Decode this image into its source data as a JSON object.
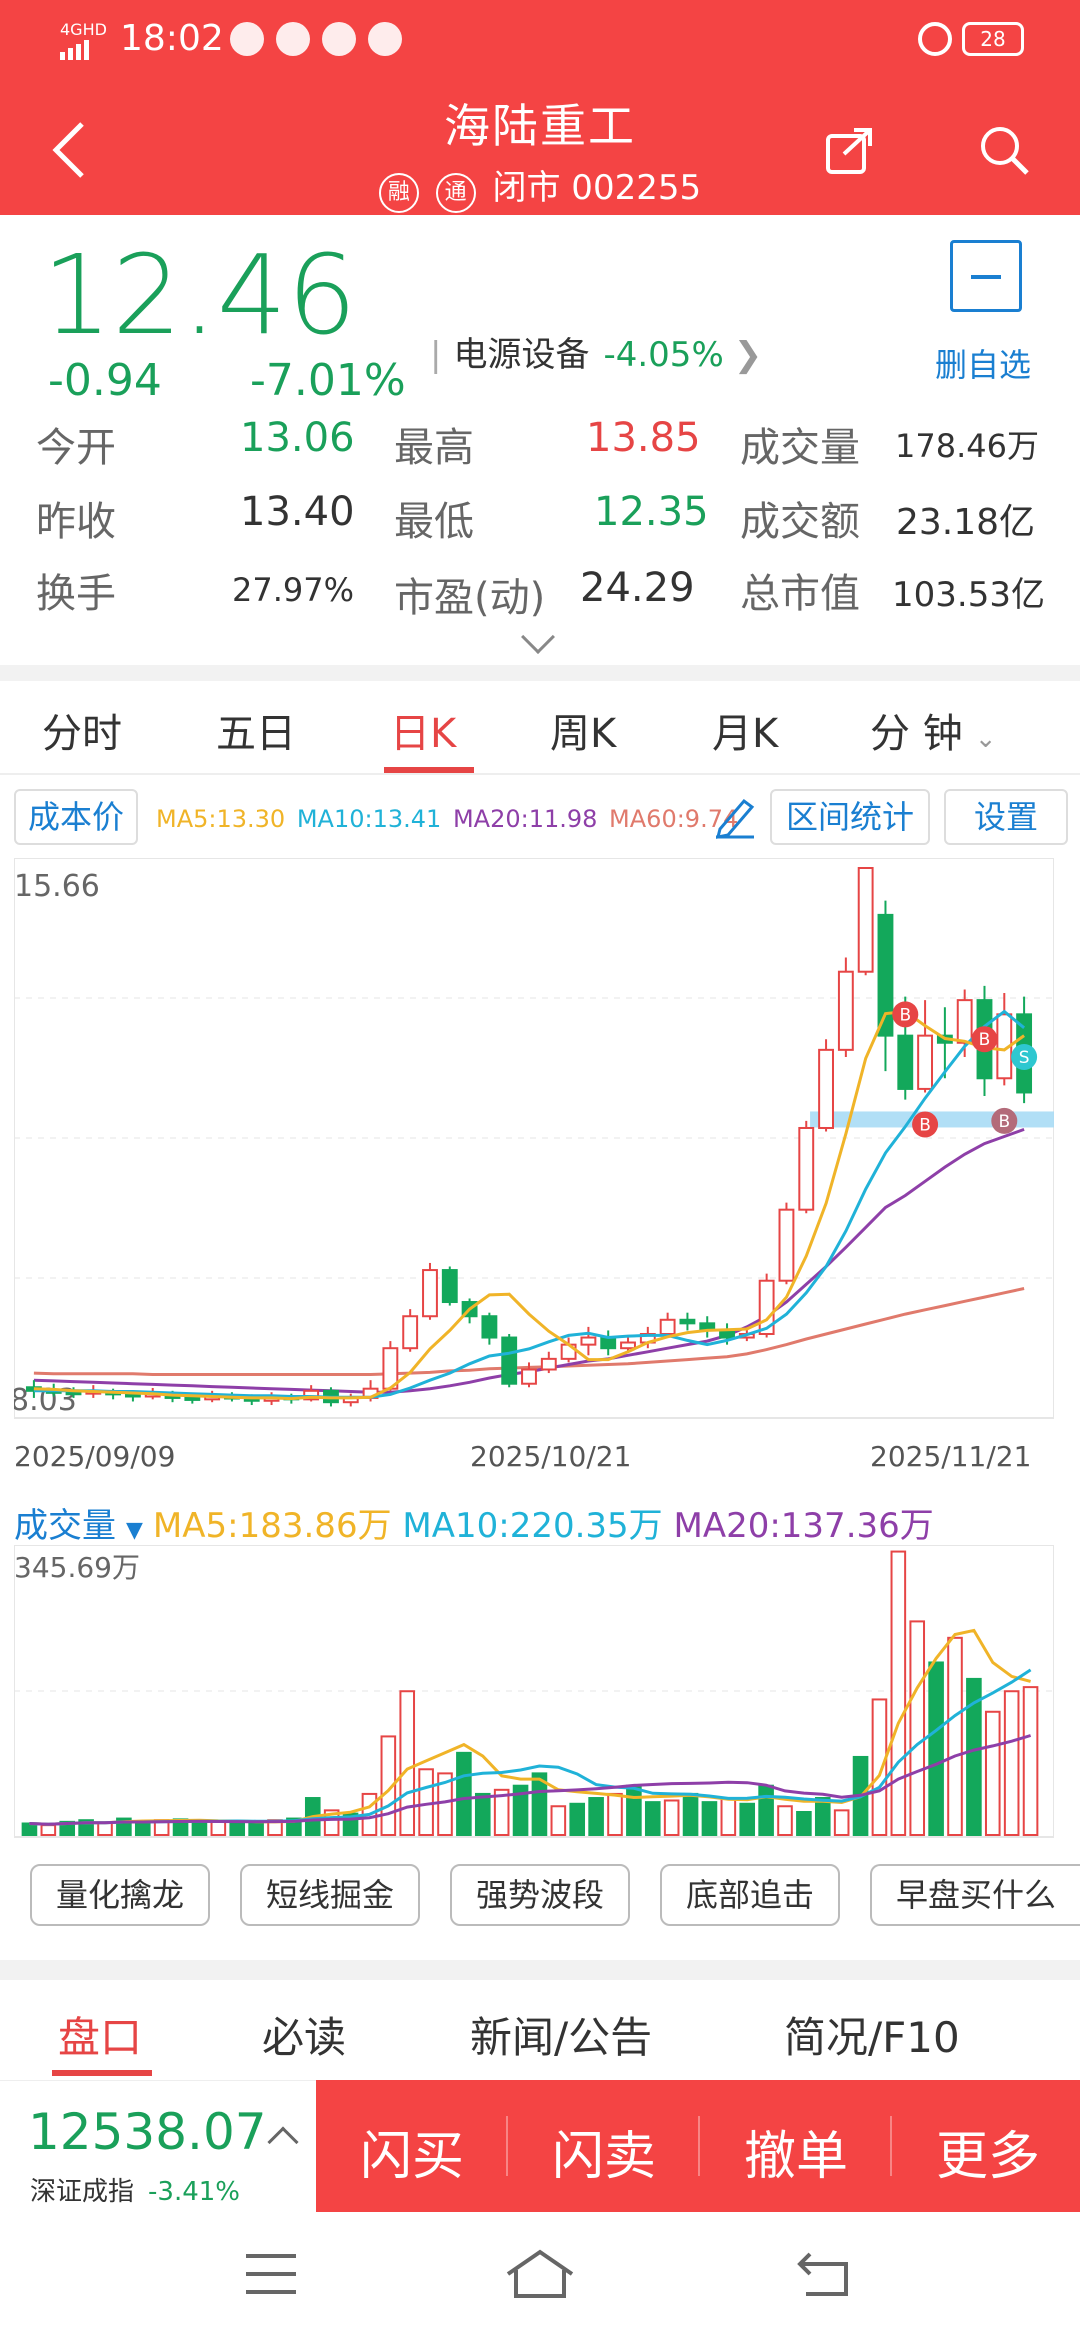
{
  "status_bar": {
    "network": "4GHD",
    "time": "18:02",
    "battery": "28"
  },
  "header": {
    "stock_name": "海陆重工",
    "badge_rong": "融",
    "badge_tong": "通",
    "status_code": "闭市 002255"
  },
  "quote": {
    "price": "12.46",
    "change": "-0.94",
    "change_pct": "-7.01%",
    "sector_name": "电源设备",
    "sector_change": "-4.05%",
    "watch_label": "删自选",
    "fields": {
      "open_label": "今开",
      "open": "13.06",
      "high_label": "最高",
      "high": "13.85",
      "volume_label": "成交量",
      "volume": "178.46万",
      "prev_label": "昨收",
      "prev": "13.40",
      "low_label": "最低",
      "low": "12.35",
      "amount_label": "成交额",
      "amount": "23.18亿",
      "turnover_label": "换手",
      "turnover": "27.97%",
      "pe_label": "市盈(动)",
      "pe": "24.29",
      "mcap_label": "总市值",
      "mcap": "103.53亿"
    }
  },
  "chart_tabs": [
    "分时",
    "五日",
    "日K",
    "周K",
    "月K",
    "分 钟"
  ],
  "chart_toolbar": {
    "cost_label": "成本价",
    "ma5": "MA5:13.30",
    "ma10": "MA10:13.41",
    "ma20": "MA20:11.98",
    "ma60": "MA60:9.74",
    "range_stats": "区间统计",
    "settings": "设置"
  },
  "colors": {
    "up": "#e64545",
    "down": "#13a85b",
    "ma5": "#f0b428",
    "ma10": "#20b2d8",
    "ma20": "#8e3fa8",
    "ma60": "#e07a6c",
    "support": "#a8dcf5"
  },
  "chart_data": {
    "type": "candlestick",
    "y_max_label": "15.66",
    "y_min_label": "8.03",
    "ylim": [
      8.03,
      15.66
    ],
    "x_labels": [
      "2025/09/09",
      "2025/10/21",
      "2025/11/21"
    ],
    "candles": [
      [
        8.35,
        8.3,
        8.45,
        8.2
      ],
      [
        8.3,
        8.28,
        8.4,
        8.22
      ],
      [
        8.28,
        8.26,
        8.35,
        8.2
      ],
      [
        8.26,
        8.29,
        8.38,
        8.2
      ],
      [
        8.29,
        8.25,
        8.33,
        8.18
      ],
      [
        8.25,
        8.22,
        8.3,
        8.15
      ],
      [
        8.22,
        8.26,
        8.34,
        8.18
      ],
      [
        8.26,
        8.2,
        8.3,
        8.14
      ],
      [
        8.2,
        8.18,
        8.26,
        8.12
      ],
      [
        8.18,
        8.22,
        8.3,
        8.14
      ],
      [
        8.22,
        8.2,
        8.28,
        8.15
      ],
      [
        8.2,
        8.16,
        8.25,
        8.1
      ],
      [
        8.16,
        8.22,
        8.28,
        8.1
      ],
      [
        8.22,
        8.18,
        8.26,
        8.12
      ],
      [
        8.18,
        8.3,
        8.38,
        8.15
      ],
      [
        8.3,
        8.14,
        8.35,
        8.08
      ],
      [
        8.14,
        8.2,
        8.26,
        8.08
      ],
      [
        8.2,
        8.33,
        8.45,
        8.15
      ],
      [
        8.33,
        8.9,
        9.0,
        8.3
      ],
      [
        8.9,
        9.35,
        9.45,
        8.85
      ],
      [
        9.35,
        10.0,
        10.1,
        9.3
      ],
      [
        10.0,
        9.55,
        10.05,
        9.5
      ],
      [
        9.55,
        9.35,
        9.6,
        9.25
      ],
      [
        9.35,
        9.05,
        9.4,
        8.95
      ],
      [
        9.05,
        8.4,
        9.1,
        8.35
      ],
      [
        8.4,
        8.6,
        8.7,
        8.35
      ],
      [
        8.6,
        8.75,
        8.85,
        8.55
      ],
      [
        8.75,
        8.95,
        9.05,
        8.7
      ],
      [
        8.95,
        9.05,
        9.2,
        8.8
      ],
      [
        9.05,
        8.9,
        9.15,
        8.8
      ],
      [
        8.9,
        8.98,
        9.05,
        8.85
      ],
      [
        8.98,
        9.1,
        9.2,
        8.9
      ],
      [
        9.1,
        9.3,
        9.4,
        9.05
      ],
      [
        9.3,
        9.25,
        9.4,
        9.15
      ],
      [
        9.25,
        9.15,
        9.35,
        9.05
      ],
      [
        9.15,
        9.05,
        9.25,
        8.95
      ],
      [
        9.05,
        9.1,
        9.2,
        9.0
      ],
      [
        9.1,
        9.85,
        9.95,
        9.05
      ],
      [
        9.85,
        10.85,
        10.95,
        9.8
      ],
      [
        10.85,
        12.0,
        12.1,
        10.8
      ],
      [
        12.0,
        13.1,
        13.25,
        11.95
      ],
      [
        13.1,
        14.2,
        14.4,
        13.0
      ],
      [
        14.2,
        15.66,
        15.66,
        14.15
      ],
      [
        15.0,
        13.3,
        15.2,
        12.8
      ],
      [
        13.3,
        12.55,
        13.85,
        12.4
      ],
      [
        12.55,
        13.3,
        13.8,
        12.5
      ],
      [
        13.3,
        13.2,
        13.7,
        12.7
      ],
      [
        13.2,
        13.8,
        13.95,
        13.0
      ],
      [
        13.8,
        12.7,
        14.0,
        12.45
      ],
      [
        12.7,
        13.6,
        13.9,
        12.6
      ],
      [
        13.6,
        12.5,
        13.85,
        12.35
      ]
    ],
    "ma5": [
      8.33,
      8.32,
      8.3,
      8.29,
      8.28,
      8.27,
      8.26,
      8.24,
      8.23,
      8.22,
      8.21,
      8.2,
      8.2,
      8.19,
      8.21,
      8.2,
      8.2,
      8.21,
      8.34,
      8.56,
      8.89,
      9.15,
      9.45,
      9.65,
      9.66,
      9.38,
      9.14,
      8.95,
      8.74,
      8.74,
      8.85,
      8.98,
      9.06,
      9.12,
      9.15,
      9.16,
      9.17,
      9.3,
      9.62,
      10.2,
      10.94,
      11.92,
      12.98,
      13.61,
      13.64,
      13.44,
      13.26,
      13.22,
      13.13,
      13.1,
      13.3
    ],
    "ma10": [
      8.3,
      8.3,
      8.3,
      8.3,
      8.29,
      8.29,
      8.28,
      8.27,
      8.26,
      8.25,
      8.24,
      8.23,
      8.23,
      8.22,
      8.22,
      8.21,
      8.21,
      8.21,
      8.25,
      8.34,
      8.45,
      8.55,
      8.68,
      8.79,
      8.83,
      8.89,
      8.99,
      9.08,
      9.11,
      9.05,
      9.07,
      9.08,
      9.08,
      9.01,
      8.95,
      9.01,
      9.09,
      9.18,
      9.38,
      9.68,
      10.05,
      10.55,
      11.14,
      11.65,
      12.02,
      12.42,
      12.79,
      13.15,
      13.43,
      13.64,
      13.41
    ],
    "ma20": [
      8.45,
      8.44,
      8.43,
      8.42,
      8.41,
      8.4,
      8.39,
      8.38,
      8.37,
      8.36,
      8.35,
      8.34,
      8.33,
      8.32,
      8.31,
      8.3,
      8.29,
      8.28,
      8.28,
      8.3,
      8.33,
      8.37,
      8.42,
      8.48,
      8.53,
      8.57,
      8.62,
      8.67,
      8.72,
      8.75,
      8.8,
      8.85,
      8.9,
      8.95,
      9.0,
      9.08,
      9.2,
      9.35,
      9.55,
      9.8,
      10.05,
      10.32,
      10.6,
      10.88,
      11.05,
      11.25,
      11.45,
      11.63,
      11.78,
      11.88,
      11.98
    ],
    "ma60": [
      8.55,
      8.54,
      8.54,
      8.54,
      8.54,
      8.54,
      8.53,
      8.53,
      8.53,
      8.53,
      8.53,
      8.53,
      8.53,
      8.53,
      8.53,
      8.53,
      8.53,
      8.53,
      8.54,
      8.55,
      8.56,
      8.58,
      8.59,
      8.61,
      8.62,
      8.63,
      8.64,
      8.65,
      8.66,
      8.67,
      8.68,
      8.7,
      8.72,
      8.74,
      8.76,
      8.78,
      8.82,
      8.88,
      8.95,
      9.03,
      9.1,
      9.17,
      9.24,
      9.31,
      9.38,
      9.44,
      9.5,
      9.56,
      9.62,
      9.68,
      9.74
    ],
    "support_level": 12.12,
    "markers": [
      {
        "i": 44,
        "label": "B",
        "price": 13.6,
        "color": "#e64545"
      },
      {
        "i": 45,
        "label": "B",
        "price": 12.05,
        "color": "#e64545"
      },
      {
        "i": 48,
        "label": "B",
        "price": 13.25,
        "color": "#e64545"
      },
      {
        "i": 49,
        "label": "B",
        "price": 12.1,
        "color": "#b36b7a"
      },
      {
        "i": 50,
        "label": "S",
        "price": 13.0,
        "color": "#2ec7d0"
      }
    ]
  },
  "volume_chart": {
    "legend_label": "成交量",
    "ma5": "MA5:183.86万",
    "ma10": "MA10:220.35万",
    "ma20": "MA20:137.36万",
    "y_max_label": "345.69万",
    "ymax": 345.69,
    "values": [
      14,
      12,
      16,
      18,
      15,
      20,
      16,
      18,
      19,
      17,
      16,
      15,
      14,
      18,
      20,
      45,
      30,
      26,
      50,
      120,
      175,
      80,
      75,
      100,
      50,
      55,
      60,
      75,
      35,
      38,
      45,
      50,
      60,
      40,
      42,
      50,
      40,
      45,
      38,
      60,
      35,
      28,
      45,
      30,
      95,
      165,
      345,
      260,
      210,
      240,
      190,
      150,
      175,
      180
    ]
  },
  "strategies": [
    "量化擒龙",
    "短线掘金",
    "强势波段",
    "底部追击",
    "早盘买什么"
  ],
  "bottom_tabs": [
    "盘口",
    "必读",
    "新闻/公告",
    "简况/F10"
  ],
  "index": {
    "value": "12538.07",
    "name": "深证成指",
    "change": "-3.41%"
  },
  "actions": [
    "闪买",
    "闪卖",
    "撤单",
    "更多"
  ]
}
